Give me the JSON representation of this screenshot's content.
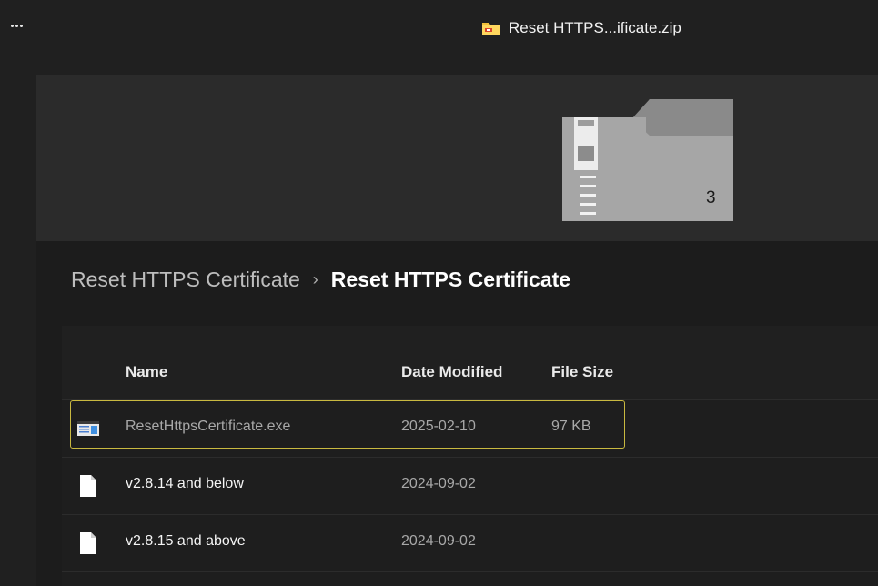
{
  "titlebar": {
    "more_label": "More options",
    "title": "Reset HTTPS...ificate.zip"
  },
  "hero": {
    "item_count": "3"
  },
  "breadcrumb": {
    "parent": "Reset HTTPS Certificate",
    "current": "Reset HTTPS Certificate"
  },
  "columns": {
    "name": "Name",
    "date": "Date Modified",
    "size": "File Size"
  },
  "files": [
    {
      "name": "ResetHttpsCertificate.exe",
      "date": "2025-02-10",
      "size": "97 KB",
      "icon": "executable-icon",
      "selected": true
    },
    {
      "name": "v2.8.14 and below",
      "date": "2024-09-02",
      "size": "",
      "icon": "document-icon",
      "selected": false
    },
    {
      "name": "v2.8.15 and above",
      "date": "2024-09-02",
      "size": "",
      "icon": "document-icon",
      "selected": false
    }
  ],
  "colors": {
    "selection_border": "#c9b940",
    "zip_icon": "#f2c23a"
  }
}
